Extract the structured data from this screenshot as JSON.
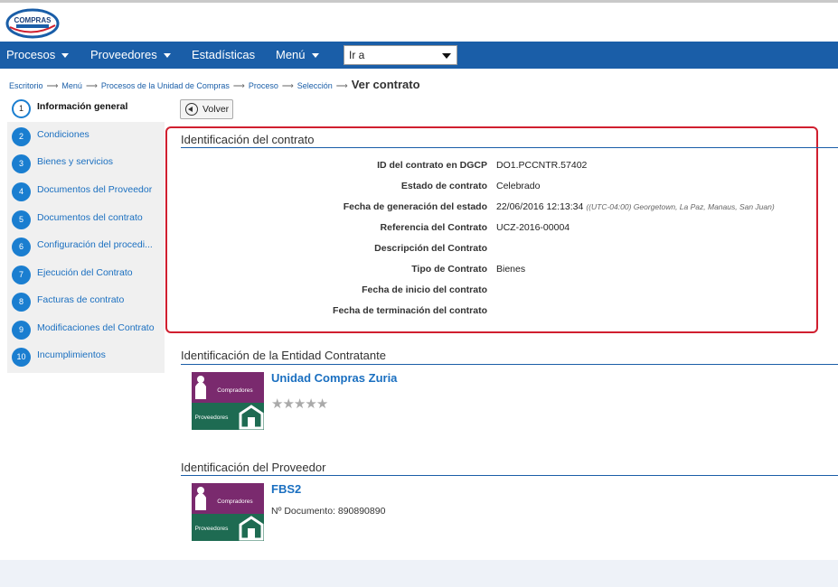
{
  "header": {
    "logo_text": "COMPRAS"
  },
  "nav": {
    "items": [
      {
        "label": "Procesos",
        "has_caret": true
      },
      {
        "label": "Proveedores",
        "has_caret": true
      },
      {
        "label": "Estadísticas",
        "has_caret": false
      },
      {
        "label": "Menú",
        "has_caret": true
      }
    ],
    "goto_value": "Ir a"
  },
  "breadcrumb": {
    "items": [
      "Escritorio",
      "Menú",
      "Procesos de la Unidad de Compras",
      "Proceso",
      "Selección"
    ],
    "current": "Ver contrato"
  },
  "steps": [
    {
      "num": "1",
      "label": "Información general",
      "active": true
    },
    {
      "num": "2",
      "label": "Condiciones"
    },
    {
      "num": "3",
      "label": "Bienes y servicios"
    },
    {
      "num": "4",
      "label": "Documentos del Proveedor"
    },
    {
      "num": "5",
      "label": "Documentos del contrato"
    },
    {
      "num": "6",
      "label": "Configuración del procedi..."
    },
    {
      "num": "7",
      "label": "Ejecución del Contrato"
    },
    {
      "num": "8",
      "label": "Facturas de contrato"
    },
    {
      "num": "9",
      "label": "Modificaciones del Contrato"
    },
    {
      "num": "10",
      "label": "Incumplimientos"
    }
  ],
  "back_button": "Volver",
  "contract": {
    "title": "Identificación del contrato",
    "fields": [
      {
        "label": "ID del contrato en DGCP",
        "value": "DO1.PCCNTR.57402"
      },
      {
        "label": "Estado de contrato",
        "value": "Celebrado"
      },
      {
        "label": "Fecha de generación del estado",
        "value": "22/06/2016 12:13:34",
        "tz": "((UTC-04:00) Georgetown, La Paz, Manaus, San Juan)"
      },
      {
        "label": "Referencia del Contrato",
        "value": "UCZ-2016-00004"
      },
      {
        "label": "Descripción del Contrato",
        "value": ""
      },
      {
        "label": "Tipo de Contrato",
        "value": "Bienes"
      },
      {
        "label": "Fecha de inicio del contrato",
        "value": ""
      },
      {
        "label": "Fecha de terminación del contrato",
        "value": ""
      }
    ]
  },
  "entity": {
    "title": "Identificación de la Entidad Contratante",
    "name": "Unidad Compras Zuria",
    "rating": 0,
    "rating_max": 5,
    "logo_top": "Compradores",
    "logo_bottom": "Proveedores"
  },
  "supplier": {
    "title": "Identificación del Proveedor",
    "name": "FBS2",
    "document": "Nº Documento: 890890890",
    "logo_top": "Compradores",
    "logo_bottom": "Proveedores"
  },
  "colors": {
    "nav_bg": "#1a5ea8",
    "link": "#1a6fc0",
    "highlight_box": "#d01f2f",
    "logo_purple": "#7a2a6e",
    "logo_green": "#1e6b52"
  }
}
